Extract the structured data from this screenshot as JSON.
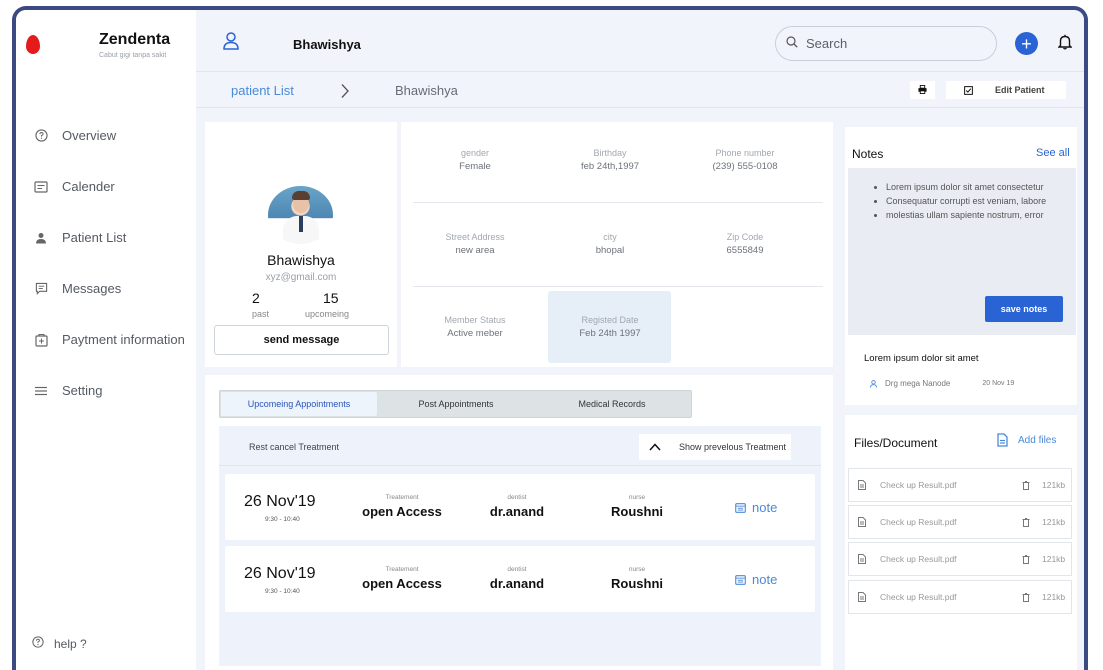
{
  "brand": {
    "name": "Zendenta",
    "tagline": "Cabut gigi tanpa sakit"
  },
  "sidebar": {
    "items": [
      {
        "label": "Overview",
        "icon": "question-circle-icon"
      },
      {
        "label": "Calender",
        "icon": "calendar-card-icon"
      },
      {
        "label": "Patient List",
        "icon": "person-icon"
      },
      {
        "label": "Messages",
        "icon": "message-icon"
      },
      {
        "label": "Paytment information",
        "icon": "wallet-icon"
      },
      {
        "label": "Setting",
        "icon": "menu-lines-icon"
      }
    ],
    "help": "help ?"
  },
  "header": {
    "user_name": "Bhawishya",
    "search_placeholder": "Search",
    "add_symbol": "+"
  },
  "breadcrumb": {
    "parent": "patient List",
    "current": "Bhawishya"
  },
  "actions": {
    "edit_label": "Edit Patient"
  },
  "profile": {
    "name": "Bhawishya",
    "email": "xyz@gmail.com",
    "past_count": "2",
    "past_label": "past",
    "upcoming_count": "15",
    "upcoming_label": "upcomeing",
    "send_label": "send message"
  },
  "details": {
    "gender": {
      "label": "gender",
      "value": "Female"
    },
    "birthday": {
      "label": "Birthday",
      "value": "feb 24th,1997"
    },
    "phone": {
      "label": "Phone number",
      "value": "(239) 555-0108"
    },
    "street": {
      "label": "Street Address",
      "value": "new area"
    },
    "city": {
      "label": "city",
      "value": "bhopal"
    },
    "zip": {
      "label": "Zip Code",
      "value": "6555849"
    },
    "member": {
      "label": "Member Status",
      "value": "Active meber"
    },
    "registered": {
      "label": "Registed Date",
      "value": "Feb 24th 1997"
    }
  },
  "appointments": {
    "tabs": [
      "Upcomeing Appointments",
      "Post Appointments",
      "Medical Records"
    ],
    "rest_cancel": "Rest cancel Treatment",
    "show_previous": "Show prevelous Treatment",
    "rows": [
      {
        "date": "26 Nov'19",
        "time": "9:30 - 10:40",
        "treatment_label": "Treatement",
        "treatment": "open Access",
        "dentist_label": "dentist",
        "dentist": "dr.anand",
        "nurse_label": "nurse",
        "nurse": "Roushni",
        "note": "note"
      },
      {
        "date": "26 Nov'19",
        "time": "9:30 - 10:40",
        "treatment_label": "Treatement",
        "treatment": "open Access",
        "dentist_label": "dentist",
        "dentist": "dr.anand",
        "nurse_label": "nurse",
        "nurse": "Roushni",
        "note": "note"
      }
    ]
  },
  "notes": {
    "title": "Notes",
    "see_all": "See all",
    "bullets": [
      "Lorem ipsum dolor sit amet consectetur",
      "Consequatur corrupti est veniam, labore",
      "molestias ullam sapiente nostrum, error"
    ],
    "save_label": "save notes",
    "item_title": "Lorem ipsum dolor sit amet",
    "item_author": "Drg mega Nanode",
    "item_date": "20 Nov 19"
  },
  "files": {
    "title": "Files/Document",
    "add_label": "Add files",
    "items": [
      {
        "name": "Check up Result.pdf",
        "size": "121kb"
      },
      {
        "name": "Check up Result.pdf",
        "size": "121kb"
      },
      {
        "name": "Check up Result.pdf",
        "size": "121kb"
      },
      {
        "name": "Check up Result.pdf",
        "size": "121kb"
      }
    ]
  },
  "colors": {
    "accent": "#2a63d4",
    "link": "#4a8ad8",
    "frame": "#3b4a82",
    "logo": "#e51b1b"
  }
}
